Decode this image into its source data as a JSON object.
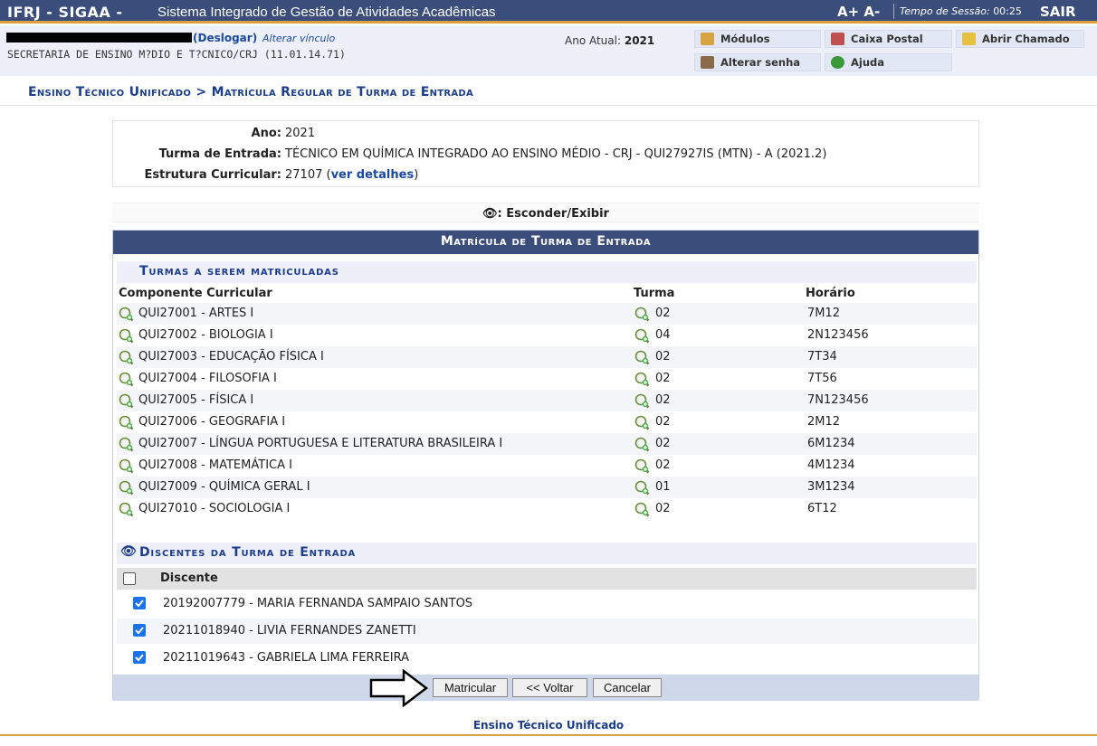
{
  "topbar": {
    "system": "IFRJ - SIGAA -",
    "system_name": "Sistema Integrado de Gestão de Atividades Acadêmicas",
    "font_controls": "A+ A-",
    "session_label": "Tempo de Sessão:",
    "session_time": "00:25",
    "logout_label": "SAIR"
  },
  "userbar": {
    "deslogar": "(Deslogar)",
    "alterar_vinculo": "Alterar vínculo",
    "unit": "SECRETARIA DE ENSINO M?DIO E T?CNICO/CRJ (11.01.14.71)",
    "ano_label": "Ano Atual:",
    "ano_value": "2021",
    "modulos": "Módulos",
    "caixa_postal": "Caixa Postal",
    "abrir_chamado": "Abrir Chamado",
    "alterar_senha": "Alterar senha",
    "ajuda": "Ajuda"
  },
  "breadcrumb": "Ensino Técnico Unificado > Matrícula Regular de Turma de Entrada",
  "info": {
    "ano_label": "Ano:",
    "ano": "2021",
    "turma_label": "Turma de Entrada:",
    "turma": "TÉCNICO EM QUÍMICA INTEGRADO AO ENSINO MÉDIO - CRJ - QUI27927IS (MTN) - A (2021.2)",
    "estrutura_label": "Estrutura Curricular:",
    "estrutura": "27107",
    "ver_detalhes": "ver detalhes"
  },
  "toggle_label": ": Esconder/Exibir",
  "panel_title": "Matrícula de Turma de Entrada",
  "turmas": {
    "title": "Turmas a serem matriculadas",
    "headers": {
      "componente": "Componente Curricular",
      "turma": "Turma",
      "horario": "Horário"
    },
    "rows": [
      {
        "comp": "QUI27001 - ARTES I",
        "turma": "02",
        "horario": "7M12"
      },
      {
        "comp": "QUI27002 - BIOLOGIA I",
        "turma": "04",
        "horario": "2N123456"
      },
      {
        "comp": "QUI27003 - EDUCAÇÃO FÍSICA I",
        "turma": "02",
        "horario": "7T34"
      },
      {
        "comp": "QUI27004 - FILOSOFIA I",
        "turma": "02",
        "horario": "7T56"
      },
      {
        "comp": "QUI27005 - FÍSICA I",
        "turma": "02",
        "horario": "7N123456"
      },
      {
        "comp": "QUI27006 - GEOGRAFIA I",
        "turma": "02",
        "horario": "2M12"
      },
      {
        "comp": "QUI27007 - LÍNGUA PORTUGUESA E LITERATURA BRASILEIRA I",
        "turma": "02",
        "horario": "6M1234"
      },
      {
        "comp": "QUI27008 - MATEMÁTICA I",
        "turma": "02",
        "horario": "4M1234"
      },
      {
        "comp": "QUI27009 - QUÍMICA GERAL I",
        "turma": "01",
        "horario": "3M1234"
      },
      {
        "comp": "QUI27010 - SOCIOLOGIA I",
        "turma": "02",
        "horario": "6T12"
      }
    ]
  },
  "discentes": {
    "title": "Discentes da Turma de Entrada",
    "header": "Discente",
    "rows": [
      {
        "label": "20192007779 - MARIA FERNANDA SAMPAIO SANTOS",
        "checked": true
      },
      {
        "label": "20211018940 - LIVIA FERNANDES ZANETTI",
        "checked": true
      },
      {
        "label": "20211019643 - GABRIELA LIMA FERREIRA",
        "checked": true
      }
    ]
  },
  "buttons": {
    "matricular": "Matricular",
    "voltar": "<< Voltar",
    "cancelar": "Cancelar"
  },
  "footer": "Ensino Técnico Unificado"
}
